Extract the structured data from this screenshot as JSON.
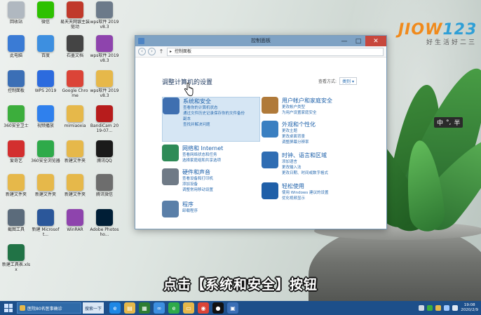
{
  "desktop_icons": [
    {
      "label": "回收站",
      "icon": "recycle-bin-icon",
      "color": "#b0b8c0"
    },
    {
      "label": "微信",
      "icon": "wechat-icon",
      "color": "#2dc100"
    },
    {
      "label": "易天天网银主装驱动",
      "icon": "bank-driver-icon",
      "color": "#c0392b"
    },
    {
      "label": "wps软件 2019 v8.3",
      "icon": "wps-installer-icon",
      "color": "#6c7a8a"
    },
    {
      "label": "此电脑",
      "icon": "this-pc-icon",
      "color": "#3a7bd5"
    },
    {
      "label": "百度",
      "icon": "baidu-icon",
      "color": "#3d8fe0"
    },
    {
      "label": "石墨文档",
      "icon": "shimo-icon",
      "color": "#444444"
    },
    {
      "label": "wps软件 2019 v8.3",
      "icon": "winrar-icon",
      "color": "#8e44ad"
    },
    {
      "label": "控制面板",
      "icon": "control-panel-icon",
      "color": "#3b6fb6"
    },
    {
      "label": "WPS 2019",
      "icon": "wps-icon",
      "color": "#2c6bde"
    },
    {
      "label": "Google Chrome",
      "icon": "chrome-icon",
      "color": "#db4437"
    },
    {
      "label": "wps软件 2019 v8.3",
      "icon": "folder-icon",
      "color": "#e6b84a"
    },
    {
      "label": "360安全卫士",
      "icon": "360-safe-icon",
      "color": "#3cae3c"
    },
    {
      "label": "视频播放",
      "icon": "video-player-icon",
      "color": "#2f80ed"
    },
    {
      "label": "mimiaoxia",
      "icon": "folder-icon",
      "color": "#e6b84a"
    },
    {
      "label": "BandiCam 2019-07...",
      "icon": "bandicam-icon",
      "color": "#b71c1c"
    },
    {
      "label": "爱奇艺",
      "icon": "iqiyi-icon",
      "color": "#d32f2f"
    },
    {
      "label": "360安全浏览器",
      "icon": "360-browser-icon",
      "color": "#2eaa4a"
    },
    {
      "label": "新建文件夹",
      "icon": "folder-icon",
      "color": "#e6b84a"
    },
    {
      "label": "腾讯QQ",
      "icon": "qq-icon",
      "color": "#1a1a1a"
    },
    {
      "label": "新建文件夹",
      "icon": "folder-icon",
      "color": "#e6b84a"
    },
    {
      "label": "新建文件夹",
      "icon": "folder-icon",
      "color": "#e6b84a"
    },
    {
      "label": "新建文件夹",
      "icon": "folder-icon",
      "color": "#e6b84a"
    },
    {
      "label": "腾讯微信",
      "icon": "shortcut-icon",
      "color": "#6d6d6d"
    },
    {
      "label": "截图工具",
      "icon": "snipping-tool-icon",
      "color": "#5b6b7b"
    },
    {
      "label": "新建 Microsoft...",
      "icon": "word-doc-icon",
      "color": "#2b579a"
    },
    {
      "label": "WinRAR",
      "icon": "winrar-icon",
      "color": "#8e44ad"
    },
    {
      "label": "Adobe Photosho...",
      "icon": "photoshop-icon",
      "color": "#001e36"
    },
    {
      "label": "新建工具表.xlsx",
      "icon": "excel-doc-icon",
      "color": "#217346"
    }
  ],
  "logo": {
    "mark_a": "JIOW",
    "mark_b": "123",
    "sub": "好生活好二三"
  },
  "ime": {
    "items": [
      "中",
      "°,",
      "半"
    ]
  },
  "window": {
    "title": "控制面板",
    "minimize": "—",
    "maximize": "□",
    "close": "✕",
    "address": "控制面板",
    "address_prefix": "▸",
    "heading": "调整计算机的设置",
    "view_by_label": "查看方式:",
    "view_by_value": "类别 ▾",
    "categories": [
      {
        "title": "系统和安全",
        "links": [
          "查看你的计算机状态",
          "通过文件历史记录保存你的文件备份",
          "副本",
          "查找并解决问题"
        ],
        "icon": "shield-icon",
        "color": "#3f6fb0",
        "selected": true
      },
      {
        "title": "网络和 Internet",
        "links": [
          "查看网络状态和任务",
          "选择家庭组和共享选项"
        ],
        "icon": "globe-icon",
        "color": "#2e8b57"
      },
      {
        "title": "硬件和声音",
        "links": [
          "查看设备和打印机",
          "添加设备",
          "调整常用移动设置"
        ],
        "icon": "printer-icon",
        "color": "#6f7a86"
      },
      {
        "title": "程序",
        "links": [
          "卸载程序"
        ],
        "icon": "programs-icon",
        "color": "#5a7fa8"
      },
      {
        "title": "用户帐户和家庭安全",
        "links": [
          "更改帐户类型",
          "为用户设置家庭安全"
        ],
        "icon": "users-icon",
        "color": "#b07a3a"
      },
      {
        "title": "外观和个性化",
        "links": [
          "更改主题",
          "更改桌面背景",
          "调整屏幕分辨率"
        ],
        "icon": "appearance-icon",
        "color": "#3a7fc1"
      },
      {
        "title": "时钟、语言和区域",
        "links": [
          "添加语言",
          "更改输入法",
          "更改日期、时间或数字格式"
        ],
        "icon": "clock-icon",
        "color": "#2f6db3"
      },
      {
        "title": "轻松使用",
        "links": [
          "使用 Windows 建议的设置",
          "优化视频显示"
        ],
        "icon": "accessibility-icon",
        "color": "#1f5fa8"
      }
    ]
  },
  "subtitle": "点击【系统和安全】按钮",
  "taskbar": {
    "app_task": "医院80名医事确诊",
    "search": "搜索一下",
    "pinned": [
      {
        "icon": "ie-icon",
        "color": "#1e88e5",
        "glyph": "e"
      },
      {
        "icon": "explorer-icon",
        "color": "#e6b84a",
        "glyph": "▤"
      },
      {
        "icon": "store-icon",
        "color": "#2e7d32",
        "glyph": "▦"
      },
      {
        "icon": "baidu-netdisk-icon",
        "color": "#3d8fe0",
        "glyph": "∞"
      },
      {
        "icon": "360-browser-icon",
        "color": "#2eaa4a",
        "glyph": "e"
      },
      {
        "icon": "folder-icon",
        "color": "#e6b84a",
        "glyph": "▭"
      },
      {
        "icon": "chrome-icon",
        "color": "#db4437",
        "glyph": "◉"
      },
      {
        "icon": "record-icon",
        "color": "#111111",
        "glyph": "●"
      },
      {
        "icon": "photos-icon",
        "color": "#3b6fb6",
        "glyph": "▣"
      }
    ],
    "time": "19:08",
    "date": "2020/2/9"
  }
}
